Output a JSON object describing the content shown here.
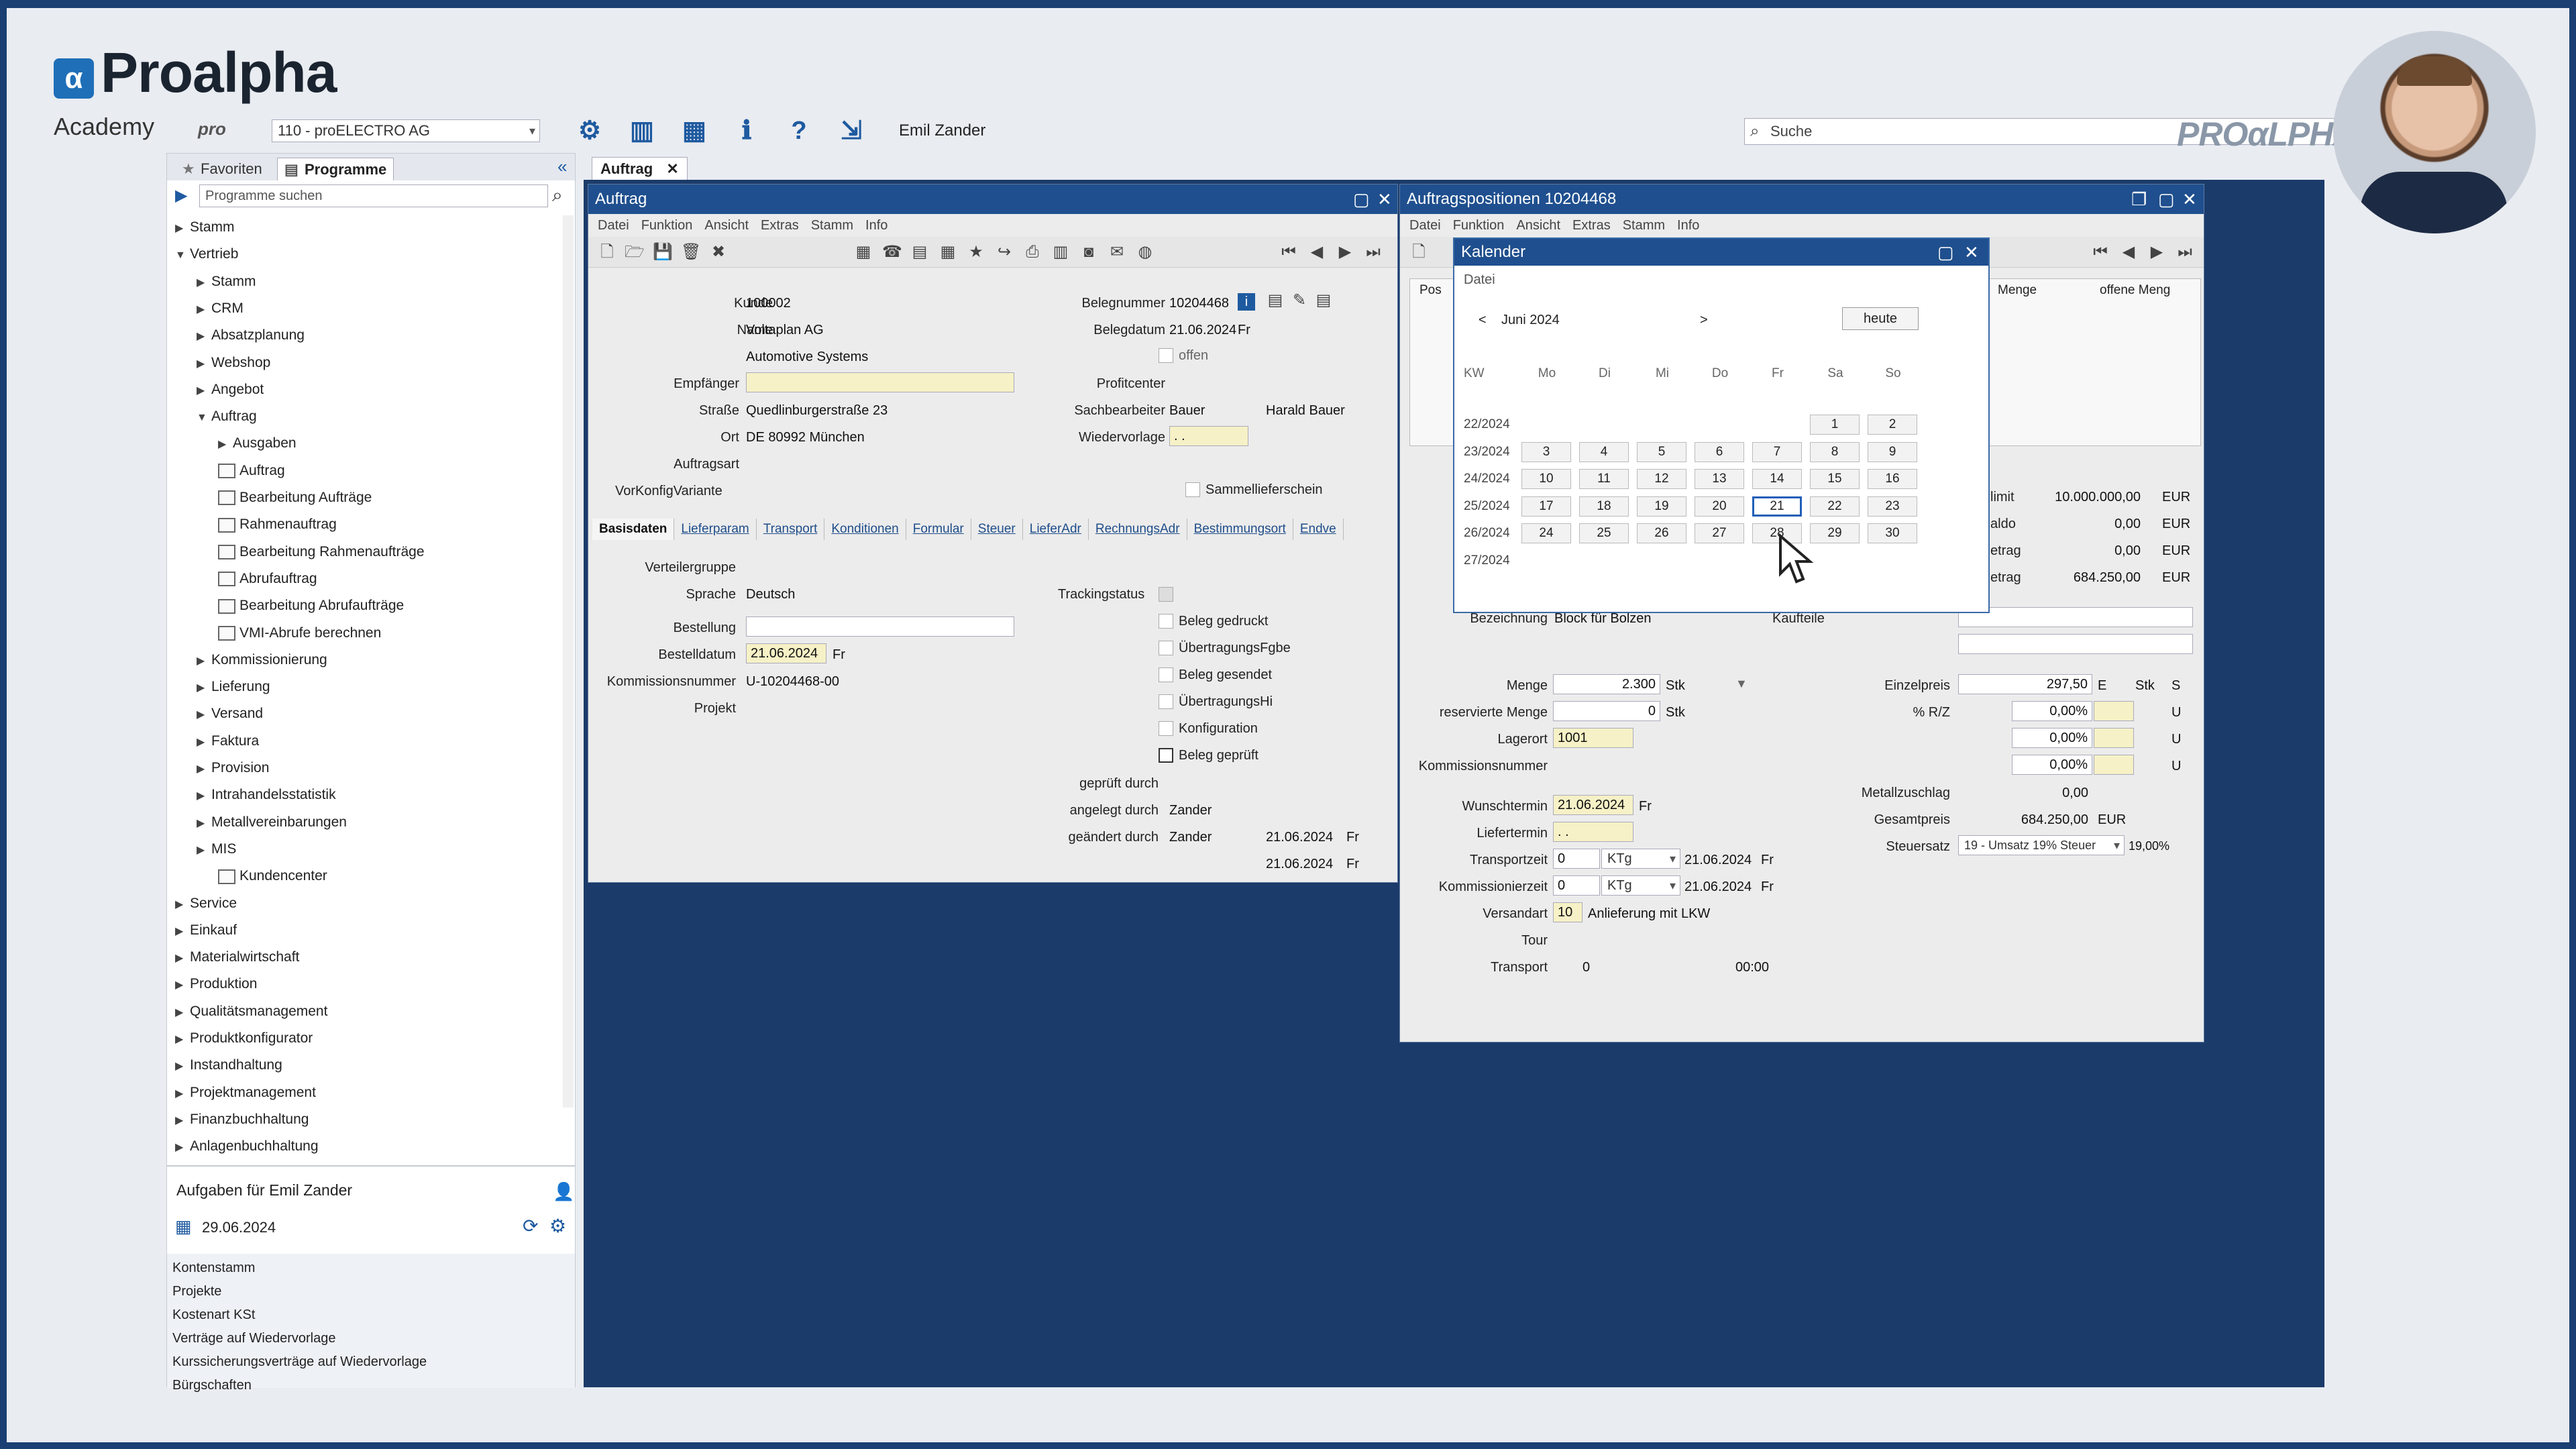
{
  "brand": {
    "q": "α",
    "name": "Proalpha",
    "sub": "Academy",
    "logo": "PROαLPHA"
  },
  "appbar": {
    "pro_badge": "pro",
    "company": "110 - proELECTRO AG",
    "user": "Emil Zander",
    "search_placeholder": "Suche",
    "icons": [
      "gear-icon",
      "panel-icon",
      "layout-icon",
      "info-icon",
      "help-icon",
      "exit-icon"
    ]
  },
  "nav": {
    "tabs": [
      "Favoriten",
      "Programme"
    ],
    "search_placeholder": "Programme suchen",
    "tree": [
      {
        "label": "Stamm",
        "level": 0,
        "kind": "collapsed"
      },
      {
        "label": "Vertrieb",
        "level": 0,
        "kind": "expanded"
      },
      {
        "label": "Stamm",
        "level": 1,
        "kind": "collapsed"
      },
      {
        "label": "CRM",
        "level": 1,
        "kind": "collapsed"
      },
      {
        "label": "Absatzplanung",
        "level": 1,
        "kind": "collapsed"
      },
      {
        "label": "Webshop",
        "level": 1,
        "kind": "collapsed"
      },
      {
        "label": "Angebot",
        "level": 1,
        "kind": "collapsed"
      },
      {
        "label": "Auftrag",
        "level": 1,
        "kind": "expanded"
      },
      {
        "label": "Ausgaben",
        "level": 2,
        "kind": "collapsed"
      },
      {
        "label": "Auftrag",
        "level": 2,
        "kind": "doc"
      },
      {
        "label": "Bearbeitung Aufträge",
        "level": 2,
        "kind": "doc"
      },
      {
        "label": "Rahmenauftrag",
        "level": 2,
        "kind": "doc"
      },
      {
        "label": "Bearbeitung Rahmenaufträge",
        "level": 2,
        "kind": "doc"
      },
      {
        "label": "Abrufauftrag",
        "level": 2,
        "kind": "doc"
      },
      {
        "label": "Bearbeitung Abrufaufträge",
        "level": 2,
        "kind": "doc"
      },
      {
        "label": "VMI-Abrufe berechnen",
        "level": 2,
        "kind": "doc"
      },
      {
        "label": "Kommissionierung",
        "level": 1,
        "kind": "collapsed"
      },
      {
        "label": "Lieferung",
        "level": 1,
        "kind": "collapsed"
      },
      {
        "label": "Versand",
        "level": 1,
        "kind": "collapsed"
      },
      {
        "label": "Faktura",
        "level": 1,
        "kind": "collapsed"
      },
      {
        "label": "Provision",
        "level": 1,
        "kind": "collapsed"
      },
      {
        "label": "Intrahandelsstatistik",
        "level": 1,
        "kind": "collapsed"
      },
      {
        "label": "Metallvereinbarungen",
        "level": 1,
        "kind": "collapsed"
      },
      {
        "label": "MIS",
        "level": 1,
        "kind": "collapsed"
      },
      {
        "label": "Kundencenter",
        "level": 2,
        "kind": "doc"
      },
      {
        "label": "Service",
        "level": 0,
        "kind": "collapsed"
      },
      {
        "label": "Einkauf",
        "level": 0,
        "kind": "collapsed"
      },
      {
        "label": "Materialwirtschaft",
        "level": 0,
        "kind": "collapsed"
      },
      {
        "label": "Produktion",
        "level": 0,
        "kind": "collapsed"
      },
      {
        "label": "Qualitätsmanagement",
        "level": 0,
        "kind": "collapsed"
      },
      {
        "label": "Produktkonfigurator",
        "level": 0,
        "kind": "collapsed"
      },
      {
        "label": "Instandhaltung",
        "level": 0,
        "kind": "collapsed"
      },
      {
        "label": "Projektmanagement",
        "level": 0,
        "kind": "collapsed"
      },
      {
        "label": "Finanzbuchhaltung",
        "level": 0,
        "kind": "collapsed"
      },
      {
        "label": "Anlagenbuchhaltung",
        "level": 0,
        "kind": "collapsed"
      }
    ]
  },
  "tasks": {
    "title": "Aufgaben für Emil Zander",
    "date": "29.06.2024",
    "items": [
      "Kontenstamm",
      "Projekte",
      "Kostenart KSt",
      "Verträge auf Wiedervorlage",
      "Kurssicherungsverträge auf Wiedervorlage",
      "Bürgschaften"
    ]
  },
  "tabstrip": {
    "tab": "Auftrag"
  },
  "auftrag": {
    "title": "Auftrag",
    "menu": [
      "Datei",
      "Funktion",
      "Ansicht",
      "Extras",
      "Stamm",
      "Info"
    ],
    "labels": {
      "kunde": "Kunde",
      "name": "Name",
      "empfaenger": "Empfänger",
      "strasse": "Straße",
      "ort": "Ort",
      "auftragsart": "Auftragsart",
      "vorkonfig": "VorKonfigVariante",
      "belegnummer": "Belegnummer",
      "belegdatum": "Belegdatum",
      "offen": "offen",
      "profitcenter": "Profitcenter",
      "sachbearbeiter": "Sachbearbeiter",
      "wiedervorlage": "Wiedervorlage",
      "sammel": "Sammellieferschein",
      "verteilergruppe": "Verteilergruppe",
      "sprache": "Sprache",
      "bestellung": "Bestellung",
      "bestelldatum": "Bestelldatum",
      "kommnr": "Kommissionsnummer",
      "projekt": "Projekt",
      "trackingstatus": "Trackingstatus",
      "beleg_gedruckt": "Beleg gedruckt",
      "uebertr_fgbe": "ÜbertragungsFgbe",
      "beleg_gesendet": "Beleg gesendet",
      "uebertr_hi": "ÜbertragungsHi",
      "konfiguration": "Konfiguration",
      "beleg_geprueft": "Beleg geprüft",
      "geprueft_durch": "geprüft durch",
      "angelegt_durch": "angelegt durch",
      "geaendert_durch": "geändert durch"
    },
    "values": {
      "kunde": "100002",
      "name": "Voltaplan AG",
      "name2": "Automotive Systems",
      "strasse": "Quedlinburgerstraße 23",
      "ort": "DE 80992 München",
      "belegnummer": "10204468",
      "belegdatum": "21.06.2024",
      "belegdatum_day": "Fr",
      "sachbearbeiter": "Bauer",
      "sachbearbeiter_name": "Harald Bauer",
      "wiedervorlage": ". .",
      "sprache": "Deutsch",
      "bestelldatum": "21.06.2024",
      "bestelldatum_day": "Fr",
      "kommnr": "U-10204468-00",
      "angelegt_durch": "Zander",
      "geaendert_durch": "Zander",
      "angelegt_datum": "21.06.2024",
      "angelegt_day": "Fr",
      "geaendert_datum": "21.06.2024",
      "geaendert_day": "Fr"
    },
    "subtabs": [
      "Basisdaten",
      "Lieferparam",
      "Transport",
      "Konditionen",
      "Formular",
      "Steuer",
      "LieferAdr",
      "RechnungsAdr",
      "Bestimmungsort",
      "Endve"
    ]
  },
  "positionen": {
    "title": "Auftragspositionen 10204468",
    "menu": [
      "Datei",
      "Funktion",
      "Ansicht",
      "Extras",
      "Stamm",
      "Info"
    ],
    "grid_headers": [
      "Pos",
      "Menge",
      "offene Meng"
    ],
    "limits": [
      {
        "label": "limit",
        "value": "10.000.000,00",
        "cur": "EUR"
      },
      {
        "label": "aldo",
        "value": "0,00",
        "cur": "EUR"
      },
      {
        "label": "etrag",
        "value": "0,00",
        "cur": "EUR"
      },
      {
        "label": "etrag",
        "value": "684.250,00",
        "cur": "EUR"
      }
    ],
    "labels": {
      "bezeichnung": "Bezeichnung",
      "menge": "Menge",
      "reserviert": "reservierte Menge",
      "lagerort": "Lagerort",
      "kommnr": "Kommissionsnummer",
      "wunschtermin": "Wunschtermin",
      "liefertermin": "Liefertermin",
      "transportzeit": "Transportzeit",
      "kommissionierzeit": "Kommissionierzeit",
      "versandart": "Versandart",
      "tour": "Tour",
      "transport": "Transport",
      "einzelpreis": "Einzelpreis",
      "rz": "% R/Z",
      "metallzuschlag": "Metallzuschlag",
      "gesamtpreis": "Gesamtpreis",
      "steuersatz": "Steuersatz",
      "kaufteile": "Kaufteile"
    },
    "values": {
      "bezeichnung": "Block für Bolzen",
      "menge": "2.300",
      "menge_unit": "Stk",
      "reserviert": "0",
      "reserviert_unit": "Stk",
      "lagerort": "1001",
      "wunschtermin": "21.06.2024",
      "wunschtermin_day": "Fr",
      "liefertermin": ". .",
      "transportzeit": "0",
      "transportzeit_unit": "KTg",
      "transport_date": "21.06.2024",
      "transport_day": "Fr",
      "kommzeit": "0",
      "kommzeit_unit": "KTg",
      "komm_date": "21.06.2024",
      "komm_day": "Fr",
      "versandart": "10",
      "versandart_text": "Anlieferung mit LKW",
      "transport": "0",
      "transport_time": "00:00",
      "einzelpreis": "297,50",
      "einzelpreis_e": "E",
      "einzelpreis_unit": "Stk",
      "einzelpreis_s": "S",
      "rz1": "0,00%",
      "rz2": "0,00%",
      "rz3": "0,00%",
      "u": "U",
      "metallzuschlag": "0,00",
      "gesamtpreis": "684.250,00",
      "gesamtpreis_cur": "EUR",
      "steuersatz": "19 - Umsatz 19% Steuer",
      "steuer_pct": "19,00%"
    }
  },
  "calendar": {
    "title": "Kalender",
    "menu": "Datei",
    "month": "Juni 2024",
    "prev": "<",
    "next": ">",
    "today_button": "heute",
    "headers": [
      "KW",
      "Mo",
      "Di",
      "Mi",
      "Do",
      "Fr",
      "Sa",
      "So"
    ],
    "weeks": [
      {
        "kw": "22/2024",
        "days": [
          "",
          "",
          "",
          "",
          "",
          "1",
          "2"
        ]
      },
      {
        "kw": "23/2024",
        "days": [
          "3",
          "4",
          "5",
          "6",
          "7",
          "8",
          "9"
        ]
      },
      {
        "kw": "24/2024",
        "days": [
          "10",
          "11",
          "12",
          "13",
          "14",
          "15",
          "16"
        ]
      },
      {
        "kw": "25/2024",
        "days": [
          "17",
          "18",
          "19",
          "20",
          "21",
          "22",
          "23"
        ]
      },
      {
        "kw": "26/2024",
        "days": [
          "24",
          "25",
          "26",
          "27",
          "28",
          "29",
          "30"
        ]
      },
      {
        "kw": "27/2024",
        "days": [
          "",
          "",
          "",
          "",
          "",
          "",
          ""
        ]
      }
    ],
    "selected_day": "21"
  },
  "colors": {
    "accent": "#1f4f8e",
    "field_yellow": "#f6f1c6",
    "desktop": "#1b3b6a"
  }
}
